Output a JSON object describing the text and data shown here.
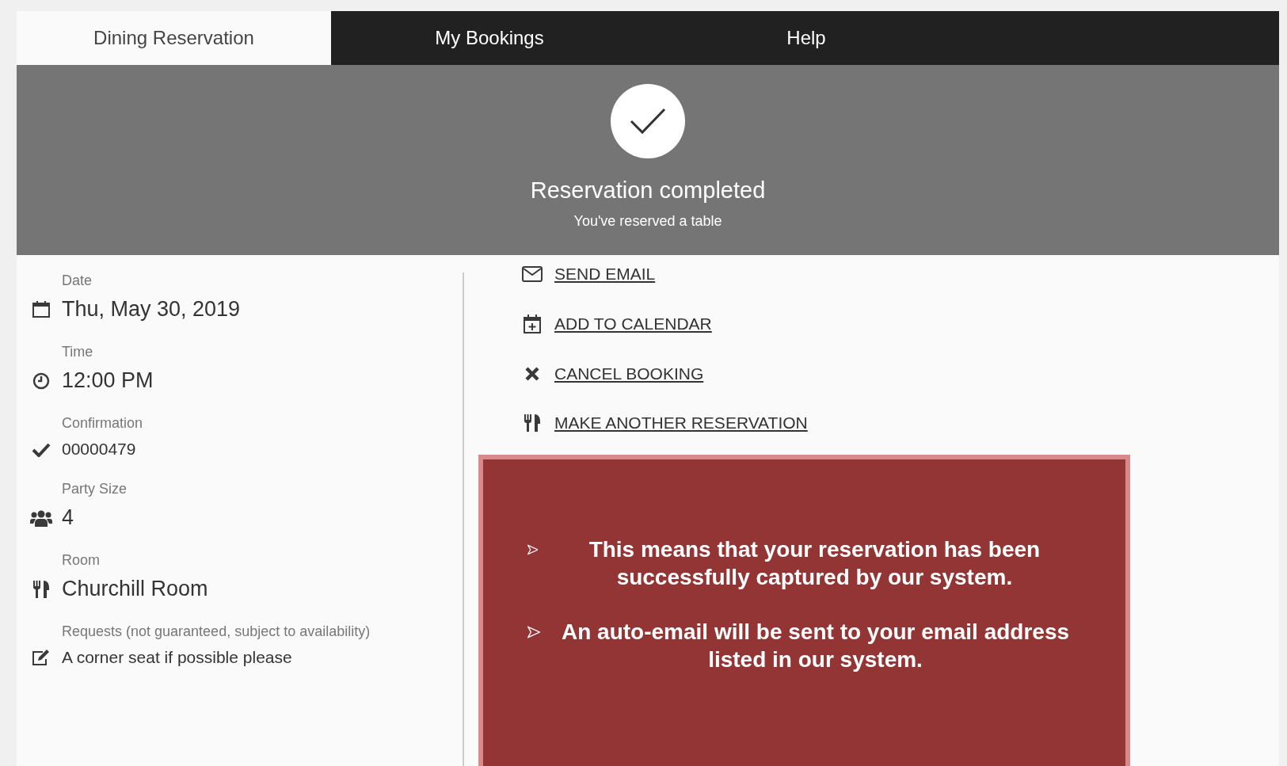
{
  "tabs": [
    {
      "label": "Dining Reservation",
      "selected": true
    },
    {
      "label": "My Bookings",
      "selected": false
    },
    {
      "label": "Help",
      "selected": false
    }
  ],
  "banner": {
    "title": "Reservation completed",
    "subtitle": "You've reserved a table"
  },
  "details": [
    {
      "kind": "date",
      "label": "Date",
      "value": "Thu, May 30, 2019"
    },
    {
      "kind": "time",
      "label": "Time",
      "value": "12:00 PM"
    },
    {
      "kind": "confirmation",
      "label": "Confirmation",
      "value": "00000479"
    },
    {
      "kind": "party",
      "label": "Party Size",
      "value": "4"
    },
    {
      "kind": "room",
      "label": "Room",
      "value": "Churchill Room"
    },
    {
      "kind": "requests",
      "label": "Requests (not guaranteed, subject to availability)",
      "value": "A corner seat if possible please"
    }
  ],
  "actions": [
    {
      "kind": "email",
      "label": "SEND EMAIL"
    },
    {
      "kind": "calendar",
      "label": "ADD TO CALENDAR"
    },
    {
      "kind": "cancel",
      "label": "CANCEL BOOKING"
    },
    {
      "kind": "reserve",
      "label": "MAKE ANOTHER RESERVATION"
    }
  ],
  "notice": {
    "points": [
      "This means that your reservation has been successfully captured by our system.",
      "An auto-email will be sent to your email address listed in our system."
    ]
  }
}
